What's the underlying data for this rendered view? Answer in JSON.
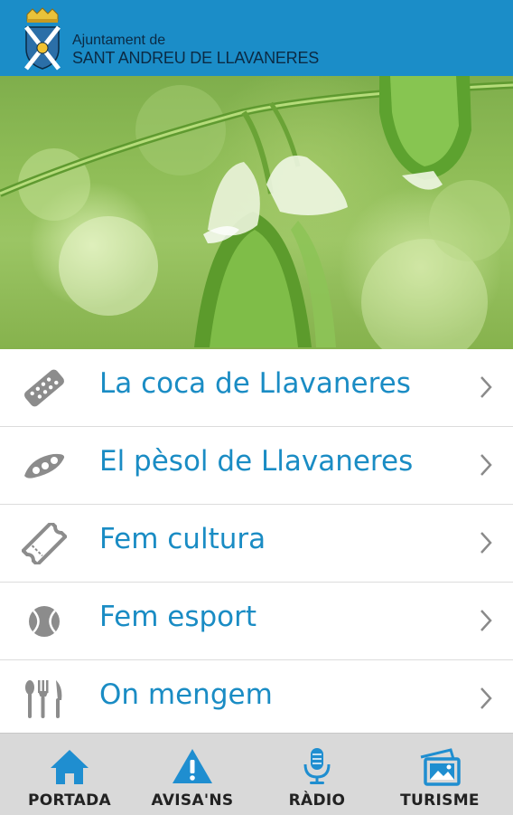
{
  "header": {
    "line1": "Ajuntament de",
    "line2": "SANT ANDREU DE LLAVANERES",
    "crest_icon": "municipal-crest-icon",
    "bg_color": "#1b8dc8"
  },
  "hero": {
    "image": "pea-plant-photo"
  },
  "menu": {
    "items": [
      {
        "label": "La coca de Llavaneres",
        "icon": "coca-icon"
      },
      {
        "label": "El pèsol de Llavaneres",
        "icon": "pea-pod-icon"
      },
      {
        "label": "Fem cultura",
        "icon": "ticket-icon"
      },
      {
        "label": "Fem esport",
        "icon": "ball-icon"
      },
      {
        "label": "On mengem",
        "icon": "cutlery-icon"
      }
    ],
    "label_color": "#1a8cc4"
  },
  "tabbar": {
    "tabs": [
      {
        "label": "PORTADA",
        "icon": "home-icon"
      },
      {
        "label": "AVISA'NS",
        "icon": "warning-icon"
      },
      {
        "label": "RÀDIO",
        "icon": "microphone-icon"
      },
      {
        "label": "TURISME",
        "icon": "photos-icon"
      }
    ],
    "icon_color": "#1f8ed0"
  }
}
